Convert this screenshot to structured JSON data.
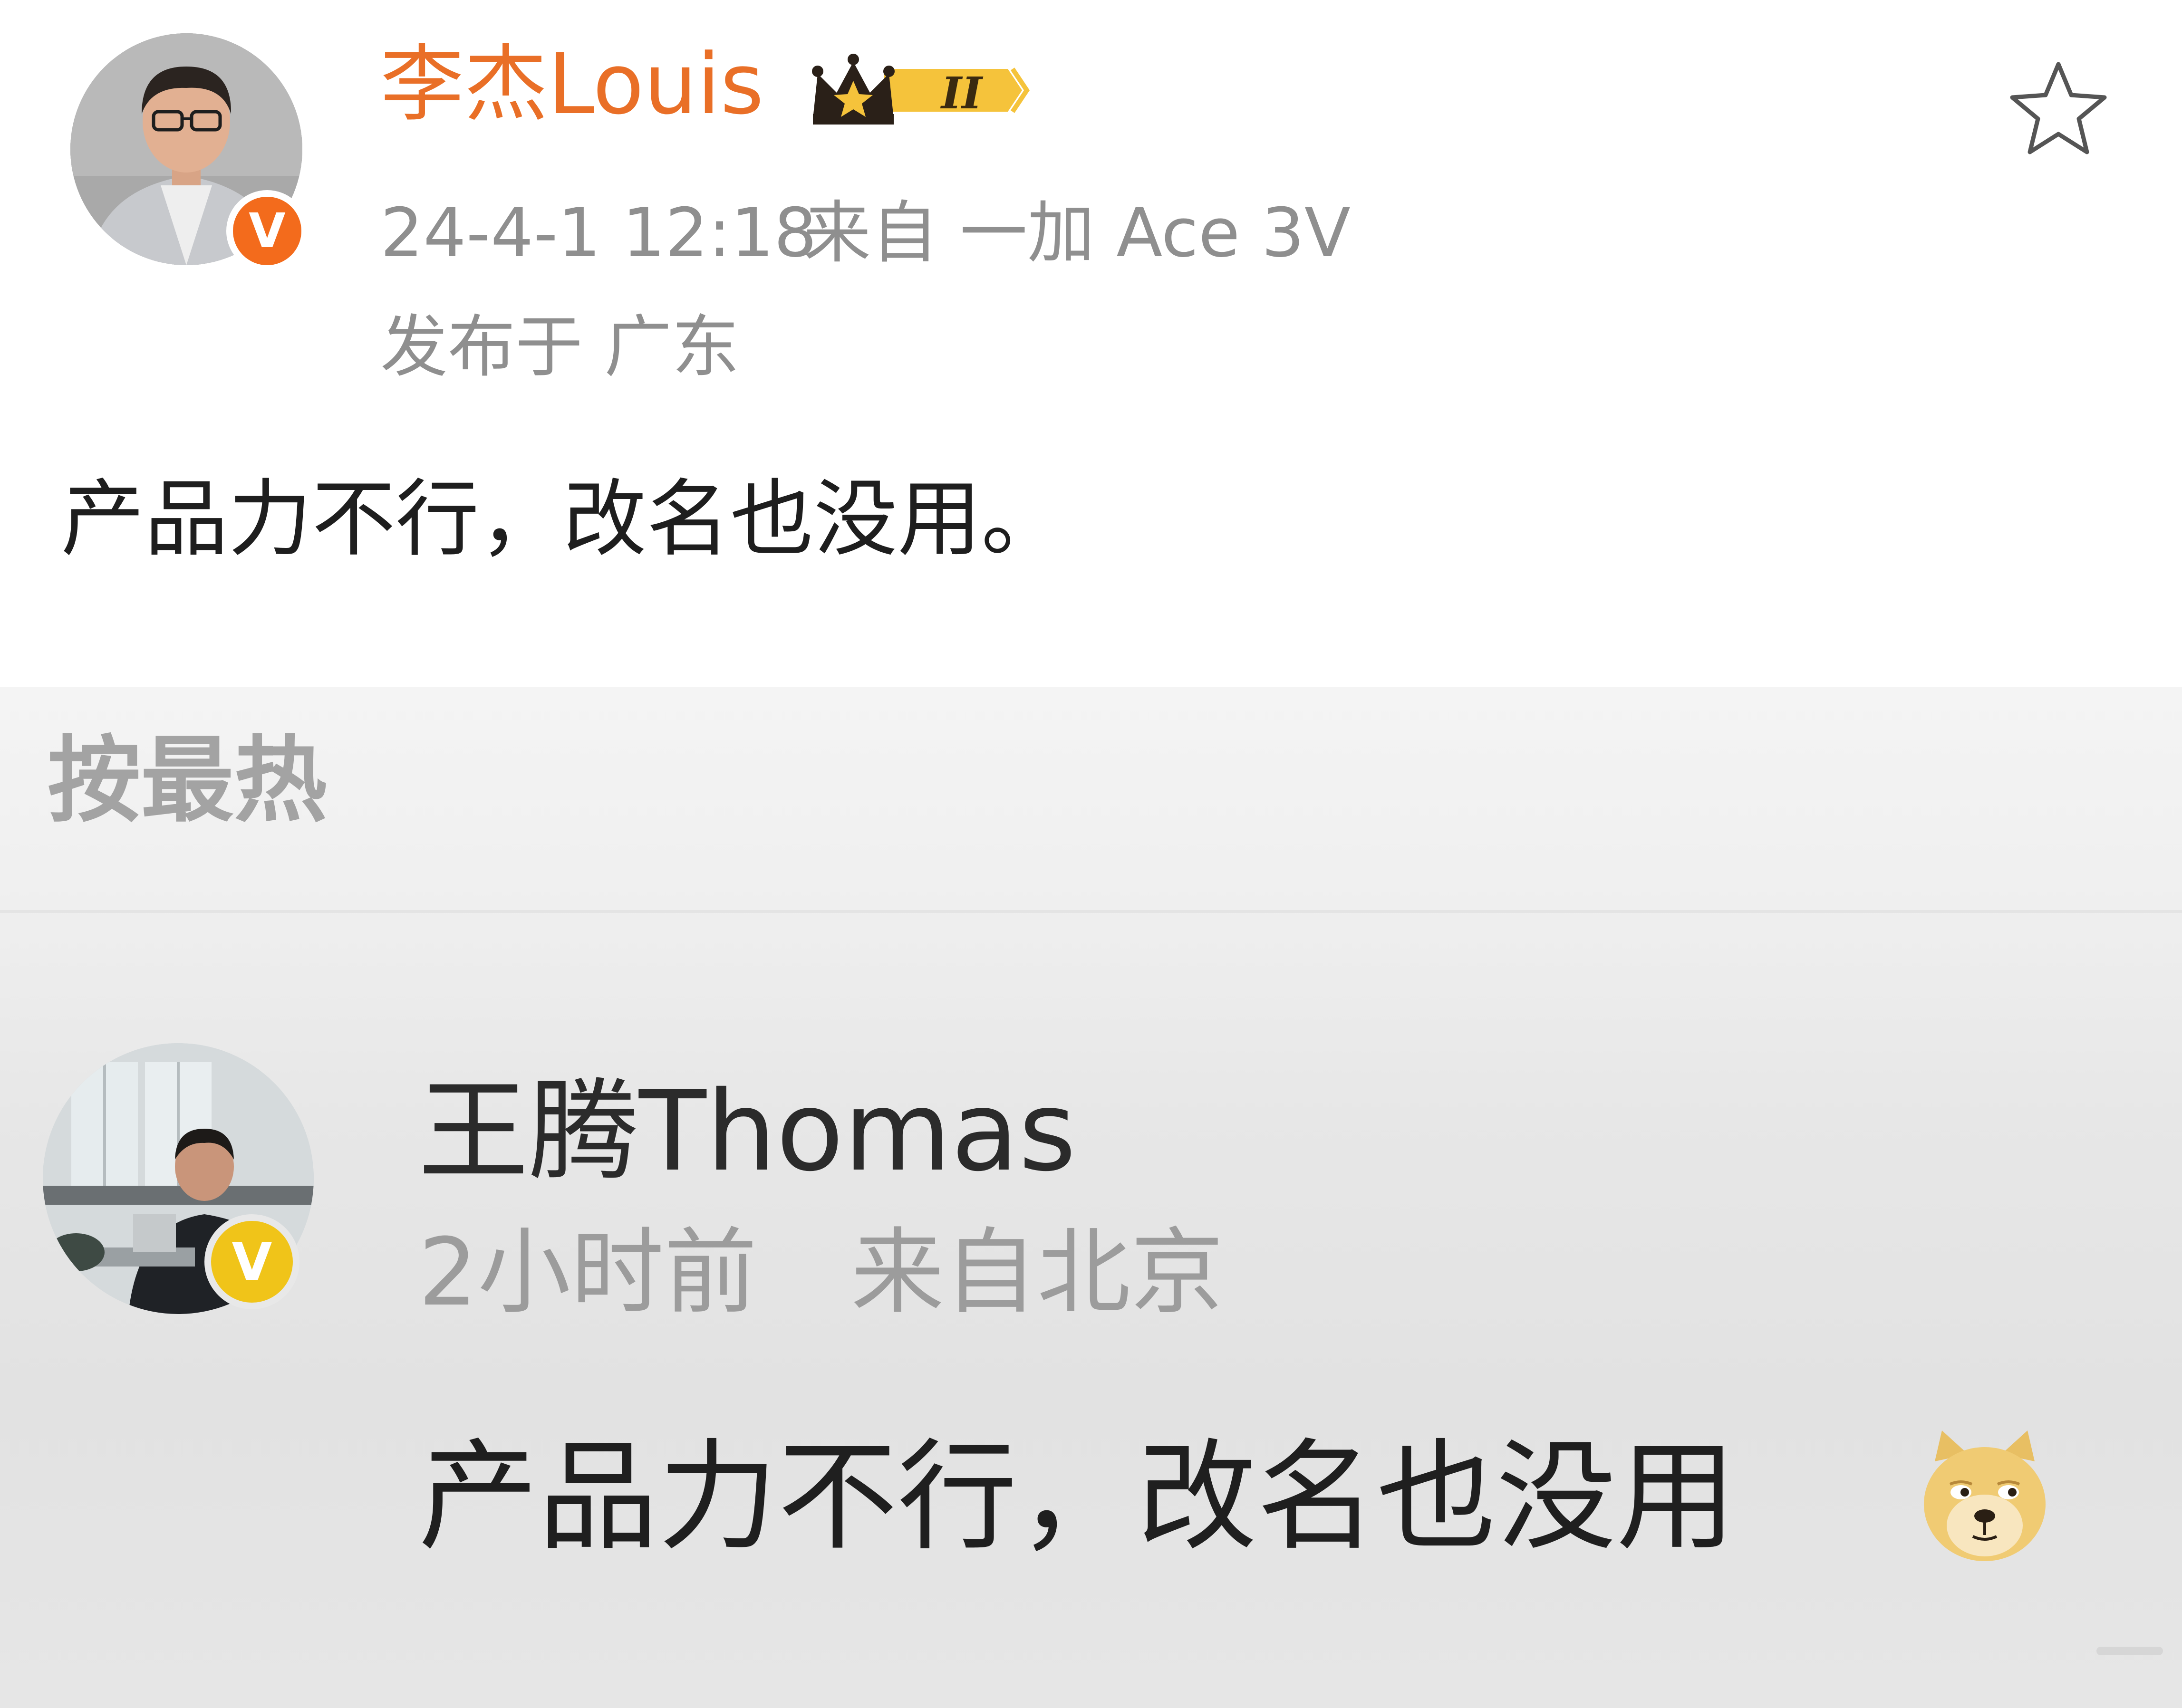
{
  "post": {
    "username": "李杰Louis",
    "crown_level": "II",
    "time": "24-4-1 12:18",
    "source": "来自 一加 Ace 3V",
    "location": "发布于 广东",
    "text": "产品力不行，改名也没用。",
    "verified_mark": "V"
  },
  "comments": {
    "sort_label": "按最热",
    "items": [
      {
        "username": "王腾Thomas",
        "time": "2小时前",
        "location": "来自北京",
        "text": "产品力不行，改名也没用",
        "verified_mark": "V",
        "emoji": "doge-emoji"
      }
    ]
  },
  "colors": {
    "username_orange": "#e96f27",
    "verified_orange": "#f36b1c",
    "verified_gold": "#f0c419",
    "meta_gray": "#8f8f8f"
  },
  "icons": {
    "favorite": "star-icon",
    "crown": "crown-icon",
    "verified": "verified-icon"
  }
}
